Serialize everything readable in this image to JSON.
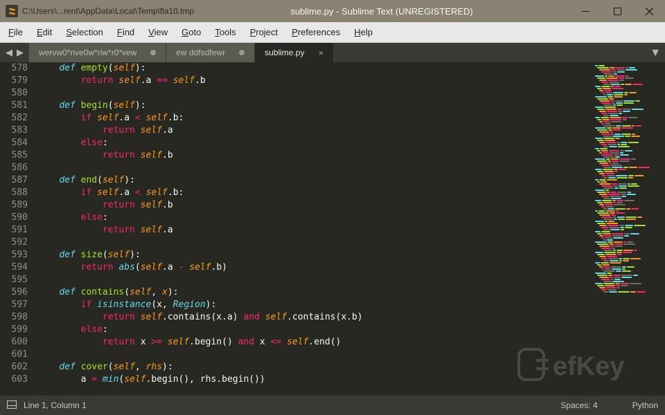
{
  "window": {
    "path_fragment": "C:\\Users\\...rent\\AppData\\Local\\Temp\\fla10.tmp",
    "title": "sublime.py - Sublime Text (UNREGISTERED)"
  },
  "menu": {
    "items": [
      "File",
      "Edit",
      "Selection",
      "Find",
      "View",
      "Goto",
      "Tools",
      "Project",
      "Preferences",
      "Help"
    ]
  },
  "tabs": {
    "items": [
      {
        "label": "wervw0*nve0w*riw*r0*vew",
        "dirty": true,
        "active": false
      },
      {
        "label": "ew ddfsdfewr",
        "dirty": true,
        "active": false
      },
      {
        "label": "sublime.py",
        "dirty": false,
        "active": true
      }
    ]
  },
  "gutter": {
    "start": 578,
    "end": 603
  },
  "code": {
    "lines": [
      [
        [
          "kw",
          "    "
        ],
        [
          "def",
          "def "
        ],
        [
          "fn",
          "empty"
        ],
        [
          "var",
          "("
        ],
        [
          "self",
          "self"
        ],
        [
          "var",
          "):"
        ]
      ],
      [
        [
          "var",
          "        "
        ],
        [
          "kw2",
          "return "
        ],
        [
          "self",
          "self"
        ],
        [
          "var",
          ".a "
        ],
        [
          "kw2",
          "=="
        ],
        [
          "var",
          " "
        ],
        [
          "self",
          "self"
        ],
        [
          "var",
          ".b"
        ]
      ],
      [
        [
          "var",
          ""
        ]
      ],
      [
        [
          "var",
          "    "
        ],
        [
          "def",
          "def "
        ],
        [
          "fn",
          "begin"
        ],
        [
          "var",
          "("
        ],
        [
          "self",
          "self"
        ],
        [
          "var",
          "):"
        ]
      ],
      [
        [
          "var",
          "        "
        ],
        [
          "kw2",
          "if "
        ],
        [
          "self",
          "self"
        ],
        [
          "var",
          ".a "
        ],
        [
          "kw2",
          "<"
        ],
        [
          "var",
          " "
        ],
        [
          "self",
          "self"
        ],
        [
          "var",
          ".b:"
        ]
      ],
      [
        [
          "var",
          "            "
        ],
        [
          "kw2",
          "return "
        ],
        [
          "self",
          "self"
        ],
        [
          "var",
          ".a"
        ]
      ],
      [
        [
          "var",
          "        "
        ],
        [
          "kw2",
          "else"
        ],
        [
          "var",
          ":"
        ]
      ],
      [
        [
          "var",
          "            "
        ],
        [
          "kw2",
          "return "
        ],
        [
          "self",
          "self"
        ],
        [
          "var",
          ".b"
        ]
      ],
      [
        [
          "var",
          ""
        ]
      ],
      [
        [
          "var",
          "    "
        ],
        [
          "def",
          "def "
        ],
        [
          "fn",
          "end"
        ],
        [
          "var",
          "("
        ],
        [
          "self",
          "self"
        ],
        [
          "var",
          "):"
        ]
      ],
      [
        [
          "var",
          "        "
        ],
        [
          "kw2",
          "if "
        ],
        [
          "self",
          "self"
        ],
        [
          "var",
          ".a "
        ],
        [
          "kw2",
          "<"
        ],
        [
          "var",
          " "
        ],
        [
          "self",
          "self"
        ],
        [
          "var",
          ".b:"
        ]
      ],
      [
        [
          "var",
          "            "
        ],
        [
          "kw2",
          "return "
        ],
        [
          "self",
          "self"
        ],
        [
          "var",
          ".b"
        ]
      ],
      [
        [
          "var",
          "        "
        ],
        [
          "kw2",
          "else"
        ],
        [
          "var",
          ":"
        ]
      ],
      [
        [
          "var",
          "            "
        ],
        [
          "kw2",
          "return "
        ],
        [
          "self",
          "self"
        ],
        [
          "var",
          ".a"
        ]
      ],
      [
        [
          "var",
          ""
        ]
      ],
      [
        [
          "var",
          "    "
        ],
        [
          "def",
          "def "
        ],
        [
          "fn",
          "size"
        ],
        [
          "var",
          "("
        ],
        [
          "self",
          "self"
        ],
        [
          "var",
          "):"
        ]
      ],
      [
        [
          "var",
          "        "
        ],
        [
          "kw2",
          "return "
        ],
        [
          "builtin",
          "abs"
        ],
        [
          "var",
          "("
        ],
        [
          "self",
          "self"
        ],
        [
          "var",
          ".a "
        ],
        [
          "kw2",
          "-"
        ],
        [
          "var",
          " "
        ],
        [
          "self",
          "self"
        ],
        [
          "var",
          ".b)"
        ]
      ],
      [
        [
          "var",
          ""
        ]
      ],
      [
        [
          "var",
          "    "
        ],
        [
          "def",
          "def "
        ],
        [
          "fn",
          "contains"
        ],
        [
          "var",
          "("
        ],
        [
          "self",
          "self"
        ],
        [
          "var",
          ", "
        ],
        [
          "param",
          "x"
        ],
        [
          "var",
          "):"
        ]
      ],
      [
        [
          "var",
          "        "
        ],
        [
          "kw2",
          "if "
        ],
        [
          "builtin",
          "isinstance"
        ],
        [
          "var",
          "(x, "
        ],
        [
          "cls",
          "Region"
        ],
        [
          "var",
          "):"
        ]
      ],
      [
        [
          "var",
          "            "
        ],
        [
          "kw2",
          "return "
        ],
        [
          "self",
          "self"
        ],
        [
          "var",
          ".contains(x.a) "
        ],
        [
          "kw2",
          "and"
        ],
        [
          "var",
          " "
        ],
        [
          "self",
          "self"
        ],
        [
          "var",
          ".contains(x.b)"
        ]
      ],
      [
        [
          "var",
          "        "
        ],
        [
          "kw2",
          "else"
        ],
        [
          "var",
          ":"
        ]
      ],
      [
        [
          "var",
          "            "
        ],
        [
          "kw2",
          "return "
        ],
        [
          "var",
          "x "
        ],
        [
          "kw2",
          ">="
        ],
        [
          "var",
          " "
        ],
        [
          "self",
          "self"
        ],
        [
          "var",
          ".begin() "
        ],
        [
          "kw2",
          "and"
        ],
        [
          "var",
          " x "
        ],
        [
          "kw2",
          "<="
        ],
        [
          "var",
          " "
        ],
        [
          "self",
          "self"
        ],
        [
          "var",
          ".end()"
        ]
      ],
      [
        [
          "var",
          ""
        ]
      ],
      [
        [
          "var",
          "    "
        ],
        [
          "def",
          "def "
        ],
        [
          "fn",
          "cover"
        ],
        [
          "var",
          "("
        ],
        [
          "self",
          "self"
        ],
        [
          "var",
          ", "
        ],
        [
          "param",
          "rhs"
        ],
        [
          "var",
          "):"
        ]
      ],
      [
        [
          "var",
          "        a "
        ],
        [
          "kw2",
          "="
        ],
        [
          "var",
          " "
        ],
        [
          "builtin",
          "min"
        ],
        [
          "var",
          "("
        ],
        [
          "self",
          "self"
        ],
        [
          "var",
          ".begin(), rhs.begin())"
        ]
      ]
    ]
  },
  "status": {
    "position": "Line 1, Column 1",
    "spaces": "Spaces: 4",
    "lang": "Python"
  },
  "watermark_text": "efKey"
}
